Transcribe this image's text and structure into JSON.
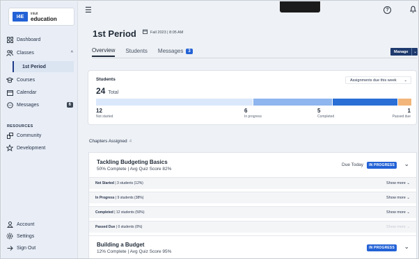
{
  "app": {
    "logo_mark": "I4E",
    "logo_line1": "intuit",
    "logo_line2": "education"
  },
  "sidebar": {
    "items": [
      {
        "label": "Dashboard",
        "icon": "grid-icon"
      },
      {
        "label": "Classes",
        "icon": "users-icon",
        "expanded": true
      },
      {
        "label": "1st Period",
        "selected": true
      },
      {
        "label": "Courses",
        "icon": "mortarboard-icon"
      },
      {
        "label": "Calendar",
        "icon": "calendar-icon"
      },
      {
        "label": "Messages",
        "icon": "chat-icon",
        "badge": "6"
      }
    ],
    "resources_heading": "RESOURCES",
    "resources": [
      {
        "label": "Community",
        "icon": "community-icon"
      },
      {
        "label": "Development",
        "icon": "star-icon"
      }
    ],
    "bottom": [
      {
        "label": "Account",
        "icon": "person-icon"
      },
      {
        "label": "Settings",
        "icon": "gear-icon"
      },
      {
        "label": "Sign Out",
        "icon": "arrow-right-icon"
      }
    ]
  },
  "header": {
    "help_glyph": "?"
  },
  "page": {
    "title": "1st Period",
    "term": "Fall 2023 | 8:05 AM",
    "tabs": [
      {
        "label": "Overview",
        "active": true
      },
      {
        "label": "Students"
      },
      {
        "label": "Messages",
        "count": "3"
      }
    ],
    "manage_label": "Manage"
  },
  "students": {
    "title": "Students",
    "total_value": "24",
    "total_label": "Total",
    "filter": "Assignments due this week",
    "stats": [
      {
        "value": "12",
        "label": "Not started",
        "color": "#dbe8fb"
      },
      {
        "value": "6",
        "label": "In progress",
        "color": "#8fb6ee"
      },
      {
        "value": "5",
        "label": "Completed",
        "color": "#2a6fd6"
      },
      {
        "value": "1",
        "label": "Passed due",
        "color": "#f2b67a"
      }
    ]
  },
  "chapters": {
    "label": "Chapters Assigned",
    "count": "4",
    "items": [
      {
        "title": "Tackling Budgeting Basics",
        "subtitle": "50% Complete | Avg Quiz Score 82%",
        "due": "Due Today",
        "status": "IN PROGRESS",
        "rows": [
          {
            "label": "Not Started",
            "detail": "| 3 students (12%)",
            "action": "Show more",
            "disabled": false
          },
          {
            "label": "In Progress",
            "detail": "| 9 students (38%)",
            "action": "Show more",
            "disabled": false
          },
          {
            "label": "Completed",
            "detail": "| 12 students (50%)",
            "action": "Show more",
            "disabled": false
          },
          {
            "label": "Passed Due",
            "detail": "| 0 students (0%)",
            "action": "Show more",
            "disabled": true
          }
        ]
      },
      {
        "title": "Building a Budget",
        "subtitle": "12% Complete | Avg Quiz Score 95%",
        "due": "",
        "status": "IN PROGRESS"
      }
    ]
  }
}
